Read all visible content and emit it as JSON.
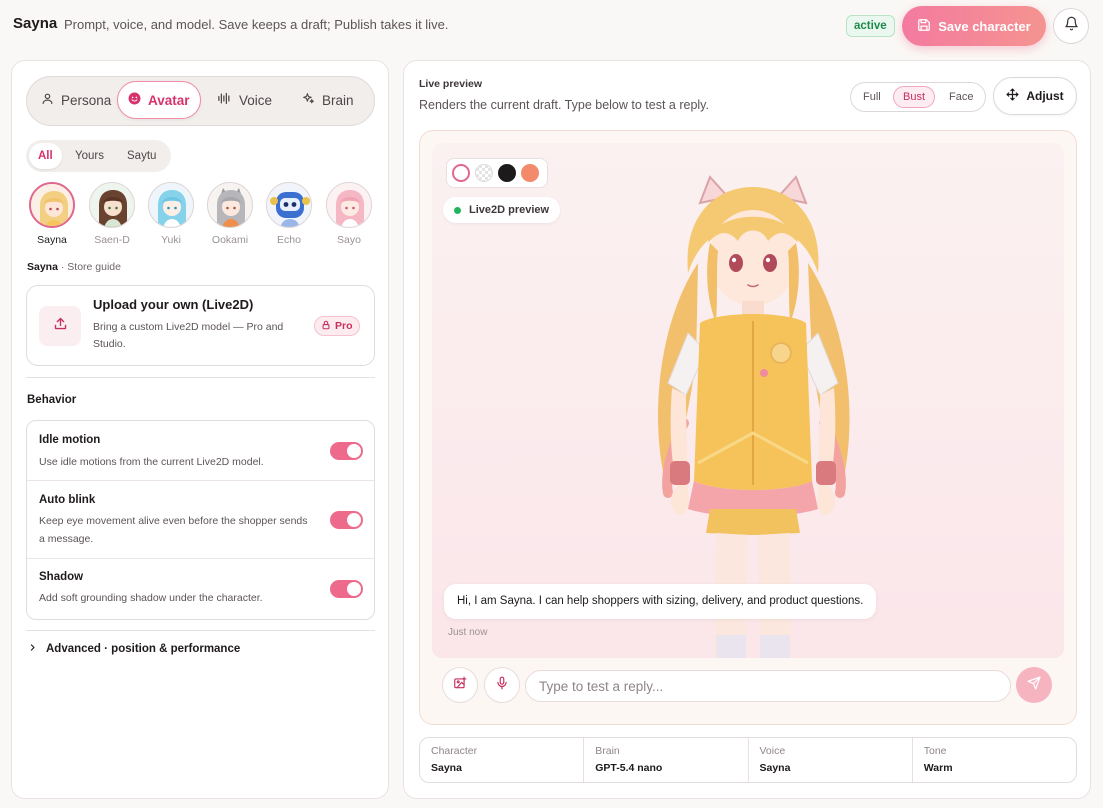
{
  "header": {
    "title": "Sayna",
    "subtitle": "Prompt, voice, and model. Save keeps a draft; Publish takes it live.",
    "status_badge": "active",
    "save_label": "Save character",
    "icons": {
      "save": "save-icon",
      "bell": "bell-icon"
    }
  },
  "tabs": [
    {
      "label": "Persona",
      "icon": "person-icon"
    },
    {
      "label": "Avatar",
      "icon": "smile-icon",
      "active": true
    },
    {
      "label": "Voice",
      "icon": "waveform-icon"
    },
    {
      "label": "Brain",
      "icon": "sparkle-icon"
    }
  ],
  "filters": [
    {
      "label": "All",
      "active": true
    },
    {
      "label": "Yours"
    },
    {
      "label": "Saytu"
    }
  ],
  "avatars": [
    {
      "name": "Sayna",
      "selected": true
    },
    {
      "name": "Saen-D"
    },
    {
      "name": "Yuki"
    },
    {
      "name": "Ookami"
    },
    {
      "name": "Echo"
    },
    {
      "name": "Sayo"
    }
  ],
  "store_guide": {
    "name": "Sayna",
    "suffix": " · Store guide"
  },
  "upload": {
    "title": "Upload your own (Live2D)",
    "description": "Bring a custom Live2D model — Pro and Studio.",
    "badge": "Pro"
  },
  "behavior": {
    "title": "Behavior",
    "rows": [
      {
        "name": "Idle motion",
        "description": "Use idle motions from the current Live2D model.",
        "enabled": true
      },
      {
        "name": "Auto blink",
        "description": "Keep eye movement alive even before the shopper sends a message.",
        "enabled": true
      },
      {
        "name": "Shadow",
        "description": "Add soft grounding shadow under the character.",
        "enabled": true
      }
    ]
  },
  "advanced_label": "Advanced · position & performance",
  "preview": {
    "title": "Live preview",
    "subtitle": "Renders the current draft. Type below to test a reply.",
    "views": [
      {
        "label": "Full"
      },
      {
        "label": "Bust",
        "active": true
      },
      {
        "label": "Face"
      }
    ],
    "adjust_label": "Adjust",
    "swatch_colors": [
      "#ffffff",
      "transparent",
      "#1c1a1a",
      "#f48a6c"
    ],
    "live2d_label": "Live2D preview",
    "message": "Hi, I am Sayna. I can help shoppers with sizing, delivery, and product questions.",
    "message_time": "Just now",
    "input_placeholder": "Type to test a reply..."
  },
  "summary": [
    {
      "label": "Character",
      "value": "Sayna"
    },
    {
      "label": "Brain",
      "value": "GPT-5.4 nano"
    },
    {
      "label": "Voice",
      "value": "Sayna"
    },
    {
      "label": "Tone",
      "value": "Warm"
    }
  ],
  "colors": {
    "accent": "#e0467a",
    "accent_gradient_start": "#f47aa0",
    "accent_gradient_end": "#f49490",
    "toggle_on": "#ee6a8d",
    "status_green": "#22b35e"
  }
}
